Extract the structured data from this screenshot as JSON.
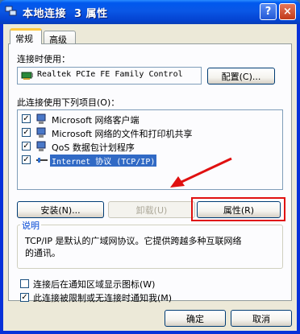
{
  "window": {
    "title": "本地连接  3 属性",
    "help_label": "?",
    "close_label": "×"
  },
  "tabs": [
    {
      "label": "常规"
    },
    {
      "label": "高级"
    }
  ],
  "connect_using": {
    "label": "连接时使用：",
    "adapter": "Realtek PCIe FE Family Control",
    "configure_button": "配置(C)..."
  },
  "components": {
    "label": "此连接使用下列项目(O)：",
    "items": [
      {
        "label": "Microsoft 网络客户端",
        "checked": true,
        "icon": "network-client-icon"
      },
      {
        "label": "Microsoft 网络的文件和打印机共享",
        "checked": true,
        "icon": "file-printer-sharing-icon"
      },
      {
        "label": "QoS 数据包计划程序",
        "checked": true,
        "icon": "qos-scheduler-icon"
      },
      {
        "label": "Internet 协议 (TCP/IP)",
        "checked": true,
        "icon": "protocol-icon",
        "selected": true
      }
    ]
  },
  "buttons": {
    "install": "安装(N)...",
    "uninstall": "卸载(U)",
    "properties": "属性(R)"
  },
  "description": {
    "title": "说明",
    "text_line1": "TCP/IP 是默认的广域网协议。它提供跨越多种互联网络",
    "text_line2": "的通讯。"
  },
  "options": {
    "show_icon": {
      "label": "连接后在通知区域显示图标(W)",
      "checked": false
    },
    "notify_limited": {
      "label": "此连接被限制或无连接时通知我(M)",
      "checked": true
    }
  },
  "footer": {
    "ok": "确定",
    "cancel": "取消"
  },
  "annotation": {
    "arrow_color": "#e01010",
    "highlight_color": "#e01010"
  }
}
